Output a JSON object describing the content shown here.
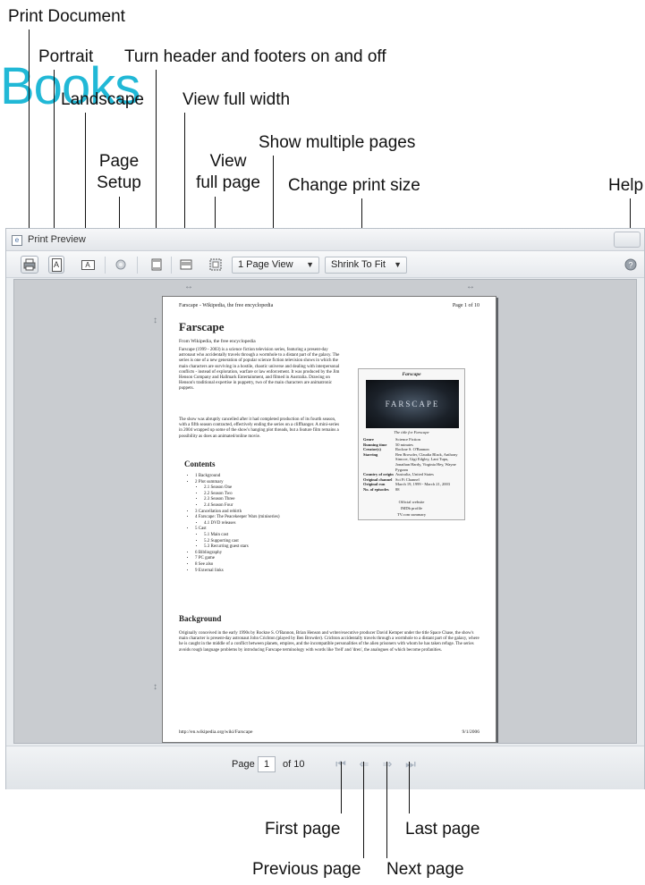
{
  "callouts": {
    "print_document": "Print Document",
    "portrait": "Portrait",
    "turn_header_footers": "Turn header and footers on and off",
    "landscape": "Landscape",
    "view_full_width": "View full width",
    "show_multiple_pages": "Show multiple pages",
    "page_setup_line1": "Page",
    "page_setup_line2": "Setup",
    "view_full_page_line1": "View",
    "view_full_page_line2": "full page",
    "change_print_size": "Change print size",
    "help": "Help",
    "first_page": "First page",
    "last_page": "Last page",
    "previous_page": "Previous page",
    "next_page": "Next page"
  },
  "watermark_logo": "Books",
  "window": {
    "title": "Print Preview"
  },
  "toolbar": {
    "print_icon": "printer-icon",
    "portrait_glyph": "A",
    "landscape_glyph": "A",
    "view_select_value": "1 Page View",
    "size_select_value": "Shrink To Fit"
  },
  "page": {
    "header_left": "Farscape - Wikipedia, the free encyclopedia",
    "header_right": "Page 1 of 10",
    "article_title": "Farscape",
    "article_subtitle": "From Wikipedia, the free encyclopedia",
    "intro_para": "Farscape (1999 - 2003) is a science fiction television series, featuring a present-day astronaut who accidentally travels through a wormhole to a distant part of the galaxy. The series is one of a new generation of popular science fiction television shows in which the main characters are surviving in a hostile, chaotic universe and dealing with interpersonal conflicts - instead of exploration, warfare or law enforcement. It was produced by the Jim Henson Company and Hallmark Entertainment, and filmed in Australia. Drawing on Henson's traditional expertise in puppetry, two of the main characters are animatronic puppets.",
    "second_para": "The show was abruptly cancelled after it had completed production of its fourth season, with a fifth season contracted, effectively ending the series on a cliffhanger. A mini-series in 2004 wrapped up some of the show's hanging plot threads, but a feature film remains a possibility as does an animated/online movie.",
    "contents_heading": "Contents",
    "contents": [
      "1 Background",
      "2 Plot summary",
      "2.1 Season One",
      "2.2 Season Two",
      "2.3 Season Three",
      "2.4 Season Four",
      "3 Cancellation and rebirth",
      "4 Farscape: The Peacekeeper Wars (miniseries)",
      "4.1 DVD releases",
      "5 Cast",
      "5.1 Main cast",
      "5.2 Supporting cast",
      "5.3 Recurring guest stars",
      "6 Bibliography",
      "7 PC game",
      "8 See also",
      "9 External links"
    ],
    "background_heading": "Background",
    "background_para": "Originally conceived in the early 1990s by Rockne S. O'Bannon, Brian Henson and writer/executive producer David Kemper under the title Space Chase, the show's main character is present-day astronaut John Crichton (played by Ben Browder). Crichton accidentally travels through a wormhole to a distant part of the galaxy, where he is caught in the middle of a conflict between planets, empires, and the incompatible personalities of the alien prisoners with whom he has taken refuge. The series avoids rough language problems by introducing Farscape terminology with words like 'frell' and 'dren', the analogues of which become profanities.",
    "footer_left": "http://en.wikipedia.org/wiki/Farscape",
    "footer_right": "9/1/2006",
    "infobox": {
      "title": "Farscape",
      "image_text": "FARSCAPE",
      "caption": "The title for Farscape",
      "rows": [
        {
          "k": "Genre",
          "v": "Science Fiction"
        },
        {
          "k": "Running time",
          "v": "50 minutes"
        },
        {
          "k": "Creator(s)",
          "v": "Rockne S. O'Bannon"
        },
        {
          "k": "Starring",
          "v": "Ben Browder, Claudia Black, Anthony Simcoe, Gigi Edgley, Lani Tupu, Jonathan Hardy, Virginia Hey, Wayne Pygram"
        },
        {
          "k": "Country of origin",
          "v": "Australia, United States"
        },
        {
          "k": "Original channel",
          "v": "Sci Fi Channel"
        },
        {
          "k": "Original run",
          "v": "March 19, 1999 - March 21, 2003"
        },
        {
          "k": "No. of episodes",
          "v": "88"
        }
      ],
      "link1": "Official website",
      "link2": "IMDb profile",
      "link3": "TV.com summary"
    }
  },
  "statusbar": {
    "page_label": "Page",
    "page_value": "1",
    "of_label": "of 10"
  }
}
